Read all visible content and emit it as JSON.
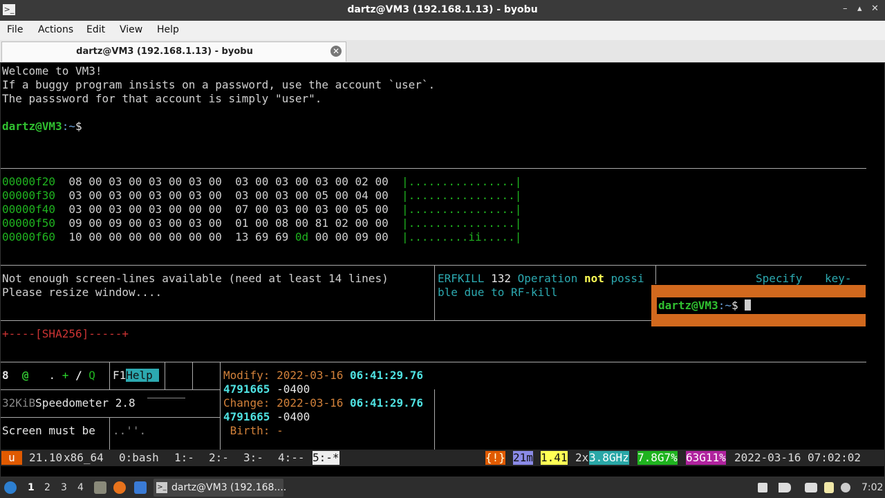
{
  "window": {
    "title": "dartz@VM3 (192.168.1.13) - byobu",
    "controls": {
      "minimize": "–",
      "maximize": "▴",
      "close": "✕"
    }
  },
  "menu": [
    "File",
    "Actions",
    "Edit",
    "View",
    "Help"
  ],
  "tab": {
    "label": "dartz@VM3 (192.168.1.13) - byobu",
    "close": "✕"
  },
  "terminal": {
    "motd": [
      "Welcome to VM3!",
      "If a buggy program insists on a password, use the account `user`.",
      "The passsword for that account is simply \"user\"."
    ],
    "prompt_user": "dartz@VM3",
    "prompt_path": ":~",
    "prompt_symbol": "$",
    "hexdump": [
      {
        "addr": "00000f20",
        "left": "08 00 03 00 03 00 03 00",
        "right": "03 00 03 00 03 00 02 00",
        "ascii": "|................|"
      },
      {
        "addr": "00000f30",
        "left": "03 00 03 00 03 00 03 00",
        "right": "03 00 03 00 05 00 04 00",
        "ascii": "|................|"
      },
      {
        "addr": "00000f40",
        "left": "03 00 03 00 03 00 00 00",
        "right": "07 00 03 00 03 00 05 00",
        "ascii": "|................|"
      },
      {
        "addr": "00000f50",
        "left": "09 00 09 00 03 00 03 00",
        "right": "01 00 08 00 81 02 00 00",
        "ascii": "|................|"
      },
      {
        "addr": "00000f60",
        "left": "10 00 00 00 00 00 00 00",
        "right_a": "13 69 69",
        "right_b": "0d",
        "right_c": "00 00 09 00",
        "ascii": "|.........ii.....|"
      }
    ],
    "pane_left": [
      "Not enough screen-lines available (need at least 14 lines)",
      "Please resize window...."
    ],
    "pane_mid": {
      "a": "ERFKILL",
      "b": "132",
      "c": "Operation",
      "d": "not",
      "e": "possi",
      "line2": "ble due to RF-kill"
    },
    "pane_right": {
      "specify": "Specify",
      "key": "key-"
    },
    "sha": "+----[SHA256]-----+",
    "game_line": {
      "n": "8",
      "at": "@",
      "dot": ".",
      "plus": "+",
      "slash": "/",
      "q": "Q",
      "f1": "F1",
      "help": "Help"
    },
    "speed": {
      "size": "32KiB",
      "name": "Speedometer 2.8"
    },
    "screen_msg": "Screen must be",
    "screen_dots": "..''.",
    "stat": {
      "modify_label": "Modify:",
      "modify_date": "2022-03-16",
      "modify_time": "06:41:29.76",
      "modify_frac": "4791665",
      "modify_tz": "-0400",
      "change_label": "Change:",
      "change_date": "2022-03-16",
      "change_time": "06:41:29.76",
      "change_frac": "4791665",
      "change_tz": "-0400",
      "birth_label": "Birth:",
      "birth_value": "-"
    }
  },
  "byobu": {
    "logo": "u",
    "release": "21.10",
    "arch": "x86_64",
    "windows": [
      "0:bash",
      "1:-",
      "2:-",
      "3:-",
      "4:--",
      "5:-*"
    ],
    "alert": "{!}",
    "uptime": "21m",
    "load": "1.41",
    "cpu_count": "2x",
    "cpu_freq": "3.8GHz",
    "mem_total": "7.8G",
    "mem_pct": "7%",
    "disk_total": "63G",
    "disk_pct": "11%",
    "datetime": "2022-03-16 07:02:02"
  },
  "taskbar": {
    "workspaces": [
      "1",
      "2",
      "3",
      "4"
    ],
    "task_label": "dartz@VM3 (192.168....",
    "clock": "7:02"
  },
  "colors": {
    "byobu_orange": "#e05a00",
    "popup_orange": "#d2691e",
    "cpu_bg": "#2aa7a7",
    "mem_bg": "#1fb31f",
    "disk_bg": "#b0239e",
    "load_bg": "#ffff55",
    "uptime_bg": "#8a8ae6"
  }
}
